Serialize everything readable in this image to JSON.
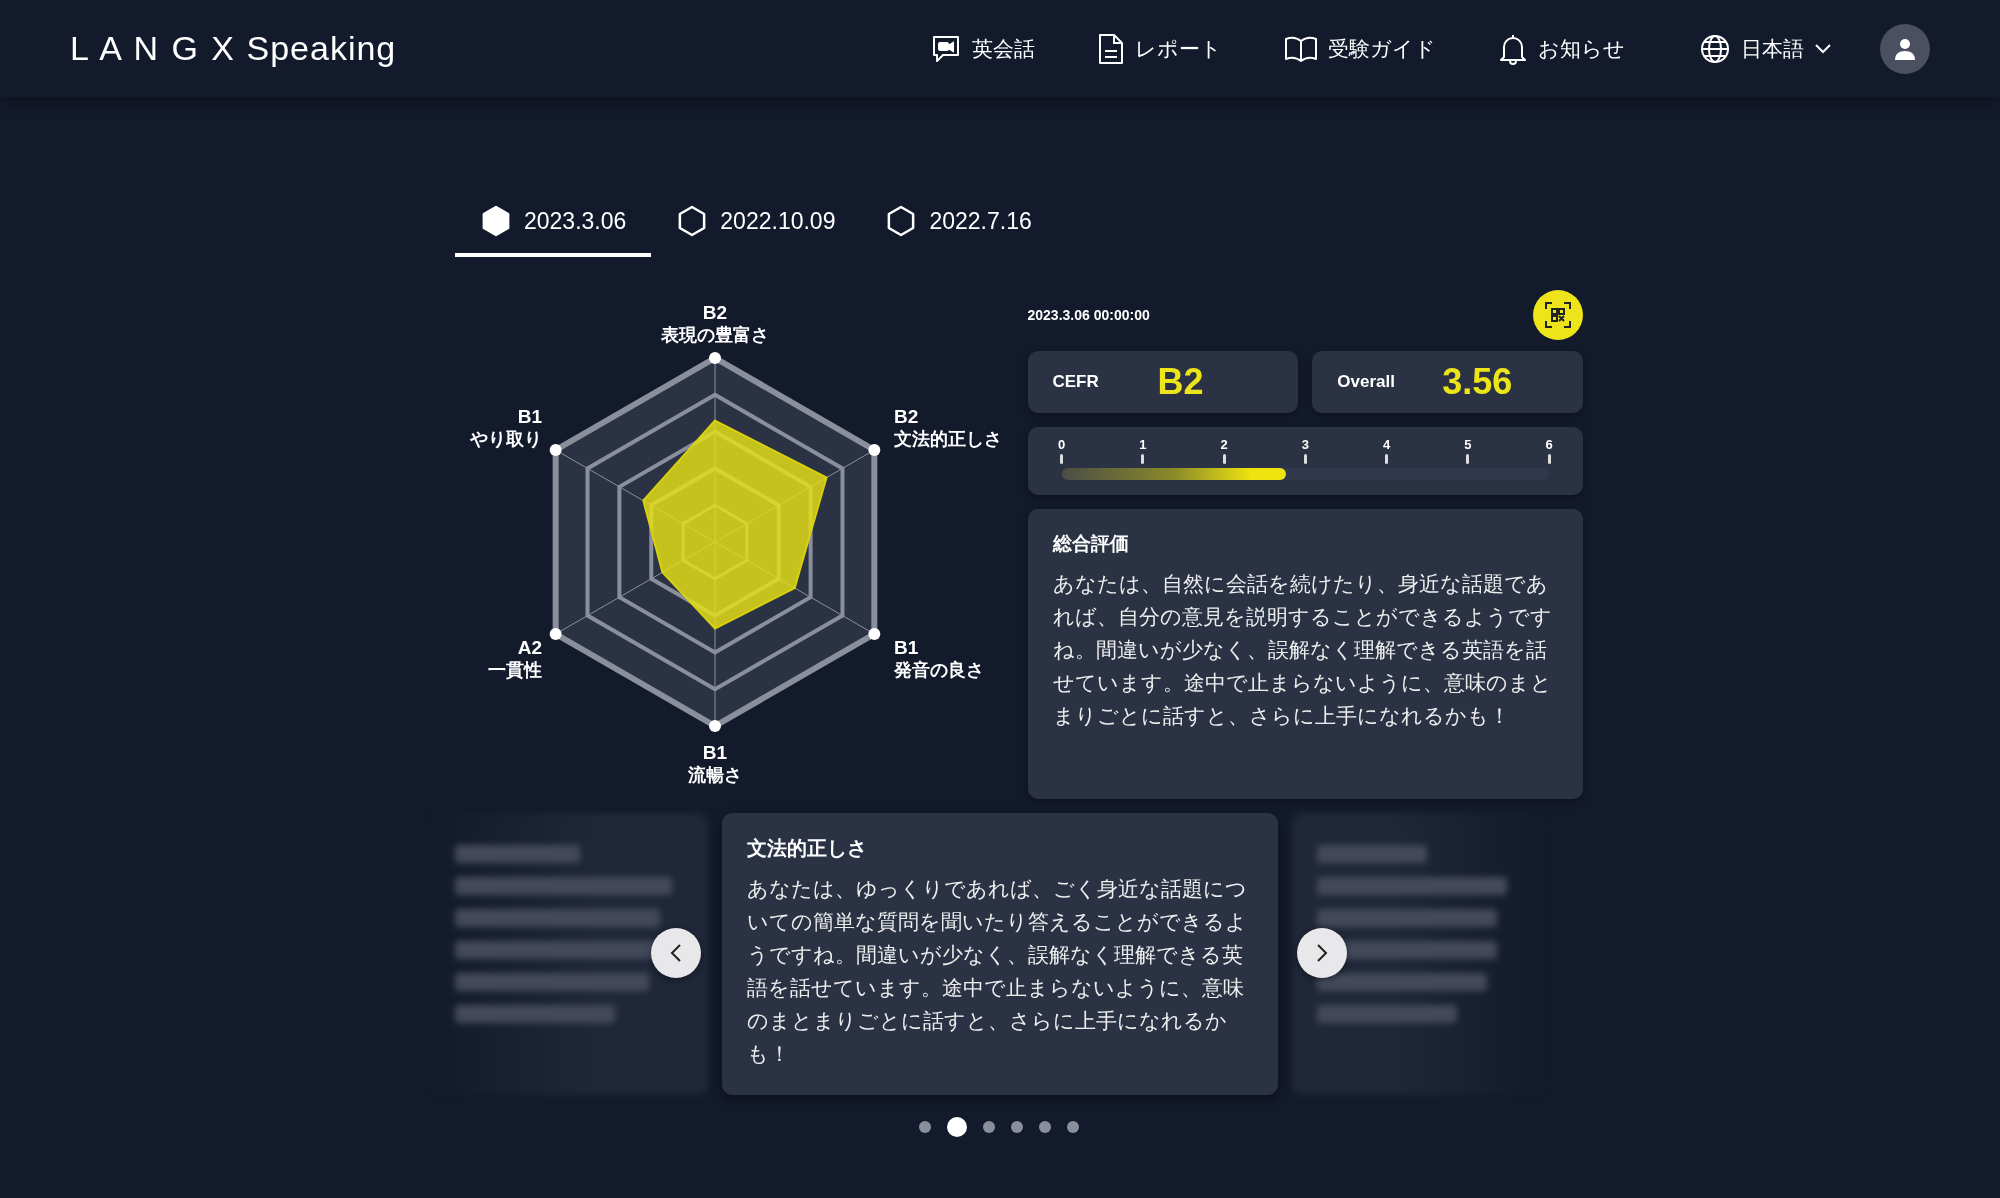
{
  "header": {
    "logo": {
      "brand": "L A N G X",
      "product": "Speaking"
    },
    "nav": [
      {
        "kind": "chat",
        "label": "英会話"
      },
      {
        "kind": "report",
        "label": "レポート"
      },
      {
        "kind": "guide",
        "label": "受験ガイド"
      },
      {
        "kind": "notice",
        "label": "お知らせ"
      }
    ],
    "language": "日本語"
  },
  "tabs": [
    {
      "label": "2023.3.06",
      "selected": true
    },
    {
      "label": "2022.10.09",
      "selected": false
    },
    {
      "label": "2022.7.16",
      "selected": false
    }
  ],
  "radar": {
    "axes": [
      {
        "level": "B2",
        "label": "表現の豊富さ"
      },
      {
        "level": "B1",
        "label": "やり取り"
      },
      {
        "level": "B2",
        "label": "文法的正しさ"
      },
      {
        "level": "A2",
        "label": "一貫性"
      },
      {
        "level": "B1",
        "label": "発音の良さ"
      },
      {
        "level": "B1",
        "label": "流暢さ"
      }
    ]
  },
  "result": {
    "datetime": "2023.3.06 00:00:00",
    "cefr": {
      "label": "CEFR",
      "value": "B2"
    },
    "overall": {
      "label": "Overall",
      "value": "3.56"
    },
    "scale": {
      "ticks": [
        "0",
        "1",
        "2",
        "3",
        "4",
        "5",
        "6"
      ],
      "level": 0.46
    },
    "summary": {
      "title": "総合評価",
      "text": "あなたは、自然に会話を続けたり、身近な話題であれば、自分の意見を説明することができるようですね。間違いが少なく、誤解なく理解できる英語を話せています。途中で止まらないように、意味のまとまりごとに話すと、さらに上手になれるかも！"
    }
  },
  "carousel": {
    "slides": [
      {
        "kind": "blurred"
      },
      {
        "kind": "active",
        "title": "文法的正しさ",
        "text": "あなたは、ゆっくりであれば、ごく身近な話題についての簡単な質問を聞いたり答えることができるようですね。間違いが少なく、誤解なく理解できる英語を話せています。途中で止まらないように、意味のまとまりごとに話すと、さらに上手になれるかも！"
      },
      {
        "kind": "blurred"
      }
    ],
    "dots": [
      {
        "selected": false
      },
      {
        "selected": true
      },
      {
        "selected": false
      },
      {
        "selected": false
      },
      {
        "selected": false
      },
      {
        "selected": false
      }
    ]
  }
}
